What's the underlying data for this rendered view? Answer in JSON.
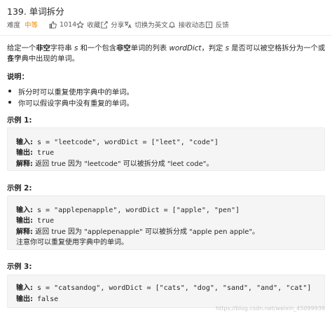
{
  "header": {
    "title": "139. 单词拆分",
    "difficulty_label": "难度",
    "difficulty_value": "中等",
    "likes": "1014",
    "favorite": "收藏",
    "share": "分享",
    "switch_lang": "切换为英文",
    "notify": "接收动态",
    "feedback": "反馈"
  },
  "description": {
    "p1": [
      "给定一个",
      "非空",
      "字符串 ",
      "s",
      " 和一个包含",
      "非空",
      "单词的列表 ",
      "wordDict",
      "，判定 ",
      "s",
      " 是否可以被空格拆分为一个或多个"
    ],
    "p2": "在字典中出现的单词。",
    "notes_title": "说明：",
    "notes": [
      "拆分时可以重复使用字典中的单词。",
      "你可以假设字典中没有重复的单词。"
    ]
  },
  "examples": [
    {
      "title": "示例 1:",
      "lines": [
        {
          "label": "输入:",
          "text": " s = \"leetcode\", wordDict = [\"leet\", \"code\"]"
        },
        {
          "label": "输出:",
          "text": " true"
        },
        {
          "label": "解释:",
          "text": " 返回 true 因为 \"leetcode\" 可以被拆分成 \"leet code\"。"
        }
      ]
    },
    {
      "title": "示例 2:",
      "lines": [
        {
          "label": "输入:",
          "text": " s = \"applepenapple\", wordDict = [\"apple\", \"pen\"]"
        },
        {
          "label": "输出:",
          "text": " true"
        },
        {
          "label": "解释:",
          "text": " 返回 true 因为 \"applepenapple\" 可以被拆分成 \"apple pen apple\"。"
        },
        {
          "label": "",
          "text": "     注意你可以重复使用字典中的单词。"
        }
      ]
    },
    {
      "title": "示例 3:",
      "lines": [
        {
          "label": "输入:",
          "text": " s = \"catsandog\", wordDict = [\"cats\", \"dog\", \"sand\", \"and\", \"cat\"]"
        },
        {
          "label": "输出:",
          "text": " false"
        }
      ]
    }
  ],
  "watermark": "https://blog.csdn.net/weixin_45099939"
}
